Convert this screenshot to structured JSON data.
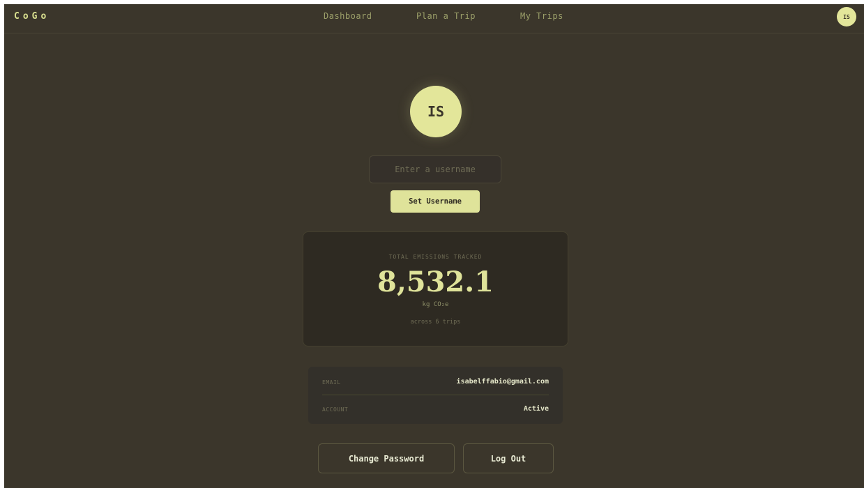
{
  "nav": {
    "brand": "CoGo",
    "links": [
      "Dashboard",
      "Plan a Trip",
      "My Trips"
    ],
    "avatar_initials": "IS"
  },
  "profile": {
    "initials": "IS",
    "username_placeholder": "Enter a username",
    "set_username_label": "Set Username"
  },
  "emissions": {
    "label": "TOTAL EMISSIONS TRACKED",
    "value": "8,532.1",
    "unit": "kg CO₂e",
    "trips_text": "across 6 trips"
  },
  "account_info": {
    "email_label": "EMAIL",
    "email_value": "isabelffabio@gmail.com",
    "account_label": "ACCOUNT",
    "account_value": "Active"
  },
  "actions": {
    "change_password_label": "Change Password",
    "logout_label": "Log Out"
  },
  "colors": {
    "background": "#3b362b",
    "accent": "#dfe39a",
    "card": "#2e2a22"
  }
}
